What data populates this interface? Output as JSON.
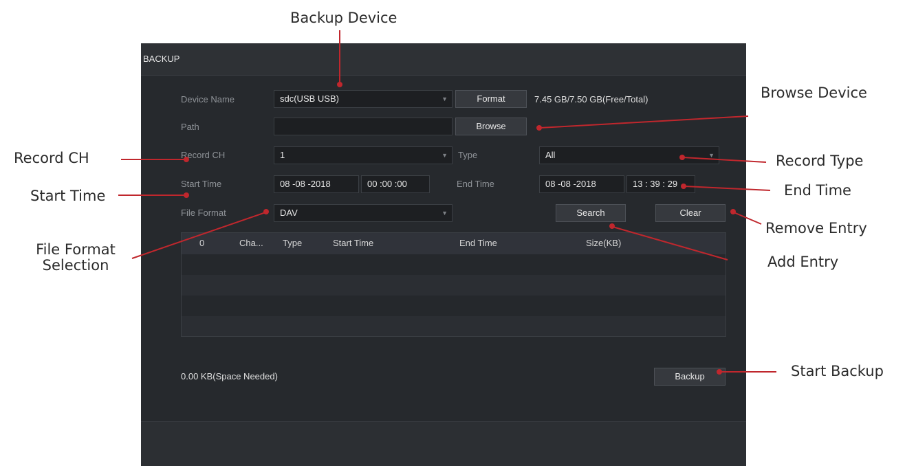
{
  "callouts": {
    "backup_device": "Backup Device",
    "browse_device": "Browse Device",
    "record_ch": "Record CH",
    "record_type": "Record Type",
    "start_time": "Start Time",
    "end_time": "End Time",
    "file_format_line1": "File Format",
    "file_format_line2": "Selection",
    "remove_entry": "Remove Entry",
    "add_entry": "Add Entry",
    "start_backup": "Start Backup"
  },
  "panel": {
    "title": "BACKUP",
    "device_name_label": "Device Name",
    "device_name_value": "sdc(USB USB)",
    "format_button": "Format",
    "capacity": "7.45 GB/7.50 GB(Free/Total)",
    "path_label": "Path",
    "path_value": "",
    "browse_button": "Browse",
    "record_ch_label": "Record CH",
    "record_ch_value": "1",
    "type_label": "Type",
    "type_value": "All",
    "start_time_label": "Start Time",
    "start_date": "08 -08 -2018",
    "start_clock": "00 :00 :00",
    "end_time_label": "End Time",
    "end_date": "08 -08 -2018",
    "end_clock": "13 : 39 : 29",
    "file_format_label": "File Format",
    "file_format_value": "DAV",
    "search_button": "Search",
    "clear_button": "Clear",
    "space_needed": "0.00 KB(Space Needed)",
    "backup_button": "Backup"
  },
  "table": {
    "columns": [
      "0",
      "Cha...",
      "Type",
      "Start Time",
      "End Time",
      "Size(KB)"
    ],
    "rows": []
  },
  "colors": {
    "panel_bg": "#26292d",
    "callout_line": "#c0272d",
    "accent_text": "#e8e8e8"
  }
}
